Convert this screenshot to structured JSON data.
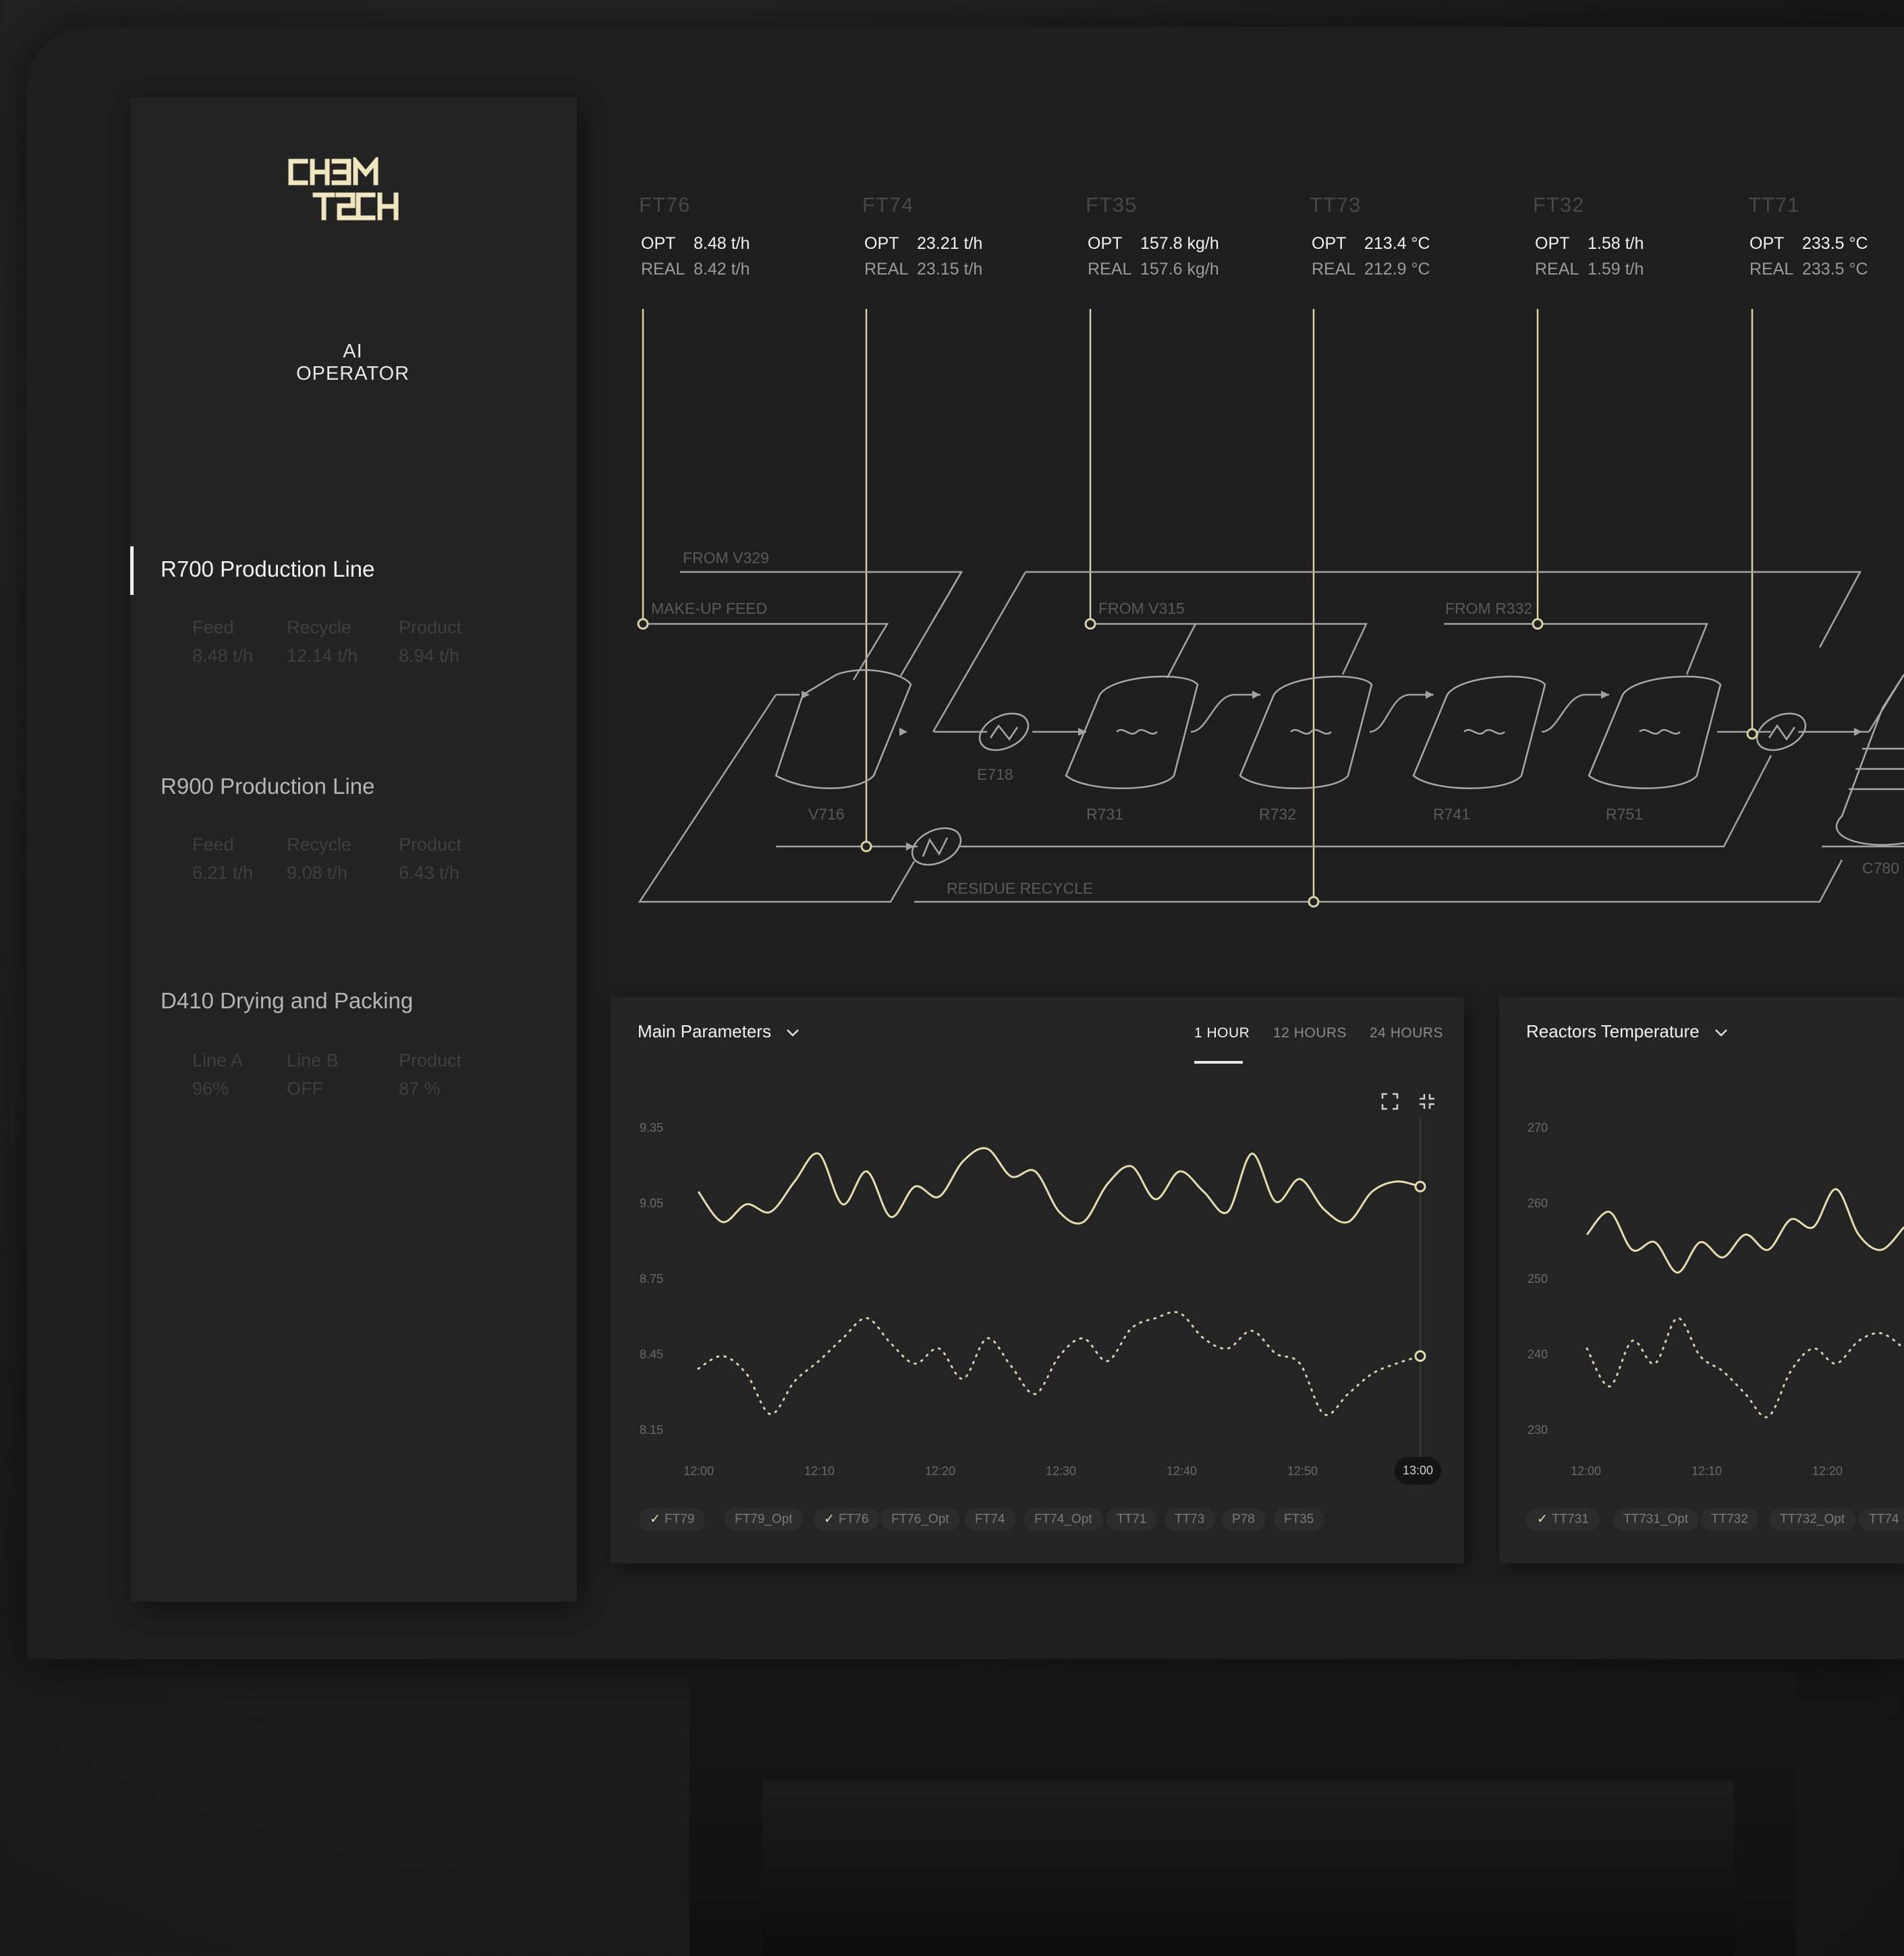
{
  "brand": {
    "logo_line1": "CHƎM",
    "logo_line2": "TƧCH",
    "subtitle": "AI OPERATOR"
  },
  "sidebar": {
    "items": [
      {
        "title": "R700 Production Line",
        "active": true,
        "stats": [
          {
            "label": "Feed",
            "value": "8.48 t/h"
          },
          {
            "label": "Recycle",
            "value": "12.14 t/h"
          },
          {
            "label": "Product",
            "value": "8.94 t/h"
          }
        ]
      },
      {
        "title": "R900 Production Line",
        "active": false,
        "stats": [
          {
            "label": "Feed",
            "value": "6.21 t/h"
          },
          {
            "label": "Recycle",
            "value": "9.08 t/h"
          },
          {
            "label": "Product",
            "value": "6.43 t/h"
          }
        ]
      },
      {
        "title": "D410 Drying and Packing",
        "active": false,
        "stats": [
          {
            "label": "Line A",
            "value": "96%"
          },
          {
            "label": "Line B",
            "value": "OFF"
          },
          {
            "label": "Product",
            "value": "87 %"
          }
        ]
      }
    ]
  },
  "sensors": [
    {
      "tag": "FT76",
      "opt_label": "OPT",
      "opt": "8.48 t/h",
      "real_label": "REAL",
      "real": "8.42 t/h"
    },
    {
      "tag": "FT74",
      "opt_label": "OPT",
      "opt": "23.21 t/h",
      "real_label": "REAL",
      "real": "23.15 t/h"
    },
    {
      "tag": "FT35",
      "opt_label": "OPT",
      "opt": "157.8 kg/h",
      "real_label": "REAL",
      "real": "157.6 kg/h"
    },
    {
      "tag": "TT73",
      "opt_label": "OPT",
      "opt": "213.4 °C",
      "real_label": "REAL",
      "real": "212.9 °C"
    },
    {
      "tag": "FT32",
      "opt_label": "OPT",
      "opt": "1.58 t/h",
      "real_label": "REAL",
      "real": "1.59 t/h"
    },
    {
      "tag": "TT71",
      "opt_label": "OPT",
      "opt": "233.5 °C",
      "real_label": "REAL",
      "real": "233.5 °C"
    }
  ],
  "diagram": {
    "labels": {
      "from_v329": "FROM V329",
      "make_up_feed": "MAKE-UP FEED",
      "from_v315": "FROM V315",
      "from_r332": "FROM R332",
      "residue_recycle": "RESIDUE RECYCLE",
      "e718": "E718",
      "v716": "V716",
      "r731": "R731",
      "r732": "R732",
      "r741": "R741",
      "r751": "R751",
      "c780": "C780"
    }
  },
  "main_panel": {
    "title": "Main Parameters",
    "tabs": [
      {
        "label": "1 HOUR",
        "active": true
      },
      {
        "label": "12 HOURS",
        "active": false
      },
      {
        "label": "24 HOURS",
        "active": false
      }
    ],
    "yticks": [
      "9.35",
      "9.05",
      "8.75",
      "8.45",
      "8.15"
    ],
    "xticks": [
      "12:00",
      "12:10",
      "12:20",
      "12:30",
      "12:40",
      "12:50",
      "13:00"
    ],
    "chips": [
      {
        "label": "FT79",
        "checked": true
      },
      {
        "label": "FT79_Opt",
        "checked": false
      },
      {
        "label": "FT76",
        "checked": true
      },
      {
        "label": "FT76_Opt",
        "checked": false
      },
      {
        "label": "FT74",
        "checked": false
      },
      {
        "label": "FT74_Opt",
        "checked": false
      },
      {
        "label": "TT71",
        "checked": false
      },
      {
        "label": "TT73",
        "checked": false
      },
      {
        "label": "P78",
        "checked": false
      },
      {
        "label": "FT35",
        "checked": false
      }
    ]
  },
  "temp_panel": {
    "title": "Reactors Temperature",
    "yticks": [
      "270",
      "260",
      "250",
      "240",
      "230"
    ],
    "xticks": [
      "12:00",
      "12:10",
      "12:20"
    ],
    "chips": [
      {
        "label": "TT731",
        "checked": true
      },
      {
        "label": "TT731_Opt",
        "checked": false
      },
      {
        "label": "TT732",
        "checked": false
      },
      {
        "label": "TT732_Opt",
        "checked": false
      },
      {
        "label": "TT74",
        "checked": false
      }
    ]
  },
  "chart_data": [
    {
      "type": "line",
      "title": "Main Parameters",
      "ylim": [
        8.15,
        9.35
      ],
      "x": [
        "12:00",
        "12:02",
        "12:04",
        "12:06",
        "12:08",
        "12:10",
        "12:12",
        "12:14",
        "12:16",
        "12:18",
        "12:20",
        "12:22",
        "12:24",
        "12:26",
        "12:28",
        "12:30",
        "12:32",
        "12:34",
        "12:36",
        "12:38",
        "12:40",
        "12:42",
        "12:44",
        "12:46",
        "12:48",
        "12:50",
        "12:52",
        "12:54",
        "12:56",
        "12:58",
        "13:00"
      ],
      "series": [
        {
          "name": "FT79",
          "style": "solid",
          "values": [
            9.1,
            8.98,
            9.05,
            9.02,
            9.14,
            9.25,
            9.05,
            9.18,
            9.0,
            9.12,
            9.08,
            9.22,
            9.27,
            9.16,
            9.18,
            9.02,
            8.98,
            9.13,
            9.2,
            9.07,
            9.18,
            9.1,
            9.02,
            9.25,
            9.06,
            9.15,
            9.03,
            8.98,
            9.1,
            9.14,
            9.12
          ]
        },
        {
          "name": "FT76",
          "style": "dotted",
          "values": [
            8.4,
            8.45,
            8.38,
            8.22,
            8.35,
            8.43,
            8.52,
            8.6,
            8.5,
            8.42,
            8.48,
            8.36,
            8.52,
            8.41,
            8.3,
            8.45,
            8.52,
            8.43,
            8.56,
            8.6,
            8.62,
            8.52,
            8.48,
            8.55,
            8.46,
            8.42,
            8.22,
            8.3,
            8.38,
            8.42,
            8.45
          ]
        }
      ]
    },
    {
      "type": "line",
      "title": "Reactors Temperature",
      "ylim": [
        230,
        270
      ],
      "x": [
        "12:00",
        "12:02",
        "12:04",
        "12:06",
        "12:08",
        "12:10",
        "12:12",
        "12:14",
        "12:16",
        "12:18",
        "12:20",
        "12:22",
        "12:24",
        "12:26",
        "12:28"
      ],
      "series": [
        {
          "name": "TT731",
          "style": "solid",
          "values": [
            256,
            259,
            254,
            255,
            251,
            255,
            253,
            256,
            254,
            258,
            257,
            262,
            256,
            254,
            257
          ]
        },
        {
          "name": "TT732",
          "style": "dotted",
          "values": [
            241,
            236,
            242,
            239,
            245,
            240,
            238,
            235,
            232,
            238,
            241,
            239,
            242,
            243,
            241
          ]
        }
      ]
    }
  ]
}
